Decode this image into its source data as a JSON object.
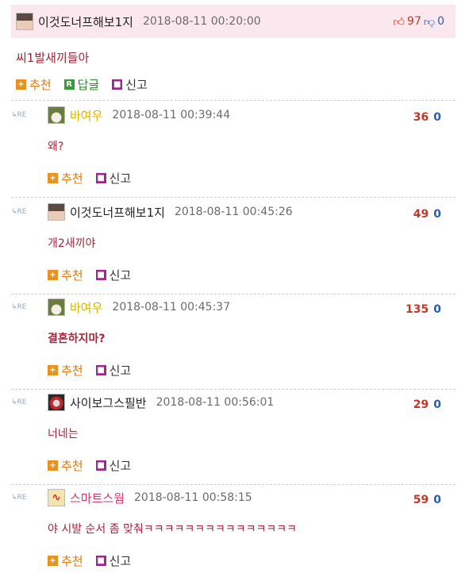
{
  "post": {
    "nickname": "이것도너프해보1지",
    "date": "2018-08-11 00:20:00",
    "up_icon": "thumbs-up-icon",
    "up_count": "97",
    "down_icon": "thumbs-down-icon",
    "down_count": "0",
    "body": "씨1발새끼들아",
    "actions": {
      "recommend": "추천",
      "reply": "답글",
      "report": "신고"
    }
  },
  "re_tag": "RE",
  "replies": [
    {
      "nickname": "바여우",
      "date": "2018-08-11 00:39:44",
      "up": "36",
      "down": "0",
      "body": "왜?",
      "recommend": "추천",
      "report": "신고"
    },
    {
      "nickname": "이것도너프해보1지",
      "date": "2018-08-11 00:45:26",
      "up": "49",
      "down": "0",
      "body": "개2새끼야",
      "recommend": "추천",
      "report": "신고"
    },
    {
      "nickname": "바여우",
      "date": "2018-08-11 00:45:37",
      "up": "135",
      "down": "0",
      "body": "결혼하지마?",
      "recommend": "추천",
      "report": "신고"
    },
    {
      "nickname": "사이보그스필반",
      "date": "2018-08-11 00:56:01",
      "up": "29",
      "down": "0",
      "body": "너네는",
      "recommend": "추천",
      "report": "신고"
    },
    {
      "nickname": "스마트스웜",
      "date": "2018-08-11 00:58:15",
      "up": "59",
      "down": "0",
      "body": "야 시발 순서 좀 맞춰ㅋㅋㅋㅋㅋㅋㅋㅋㅋㅋㅋㅋㅋㅋㅋ",
      "recommend": "추천",
      "report": "신고"
    }
  ],
  "colors": {
    "header_bg": "#fbe8ee",
    "body_text": "#a8243c",
    "upvote": "#c0392b",
    "downvote": "#2a5db0"
  }
}
